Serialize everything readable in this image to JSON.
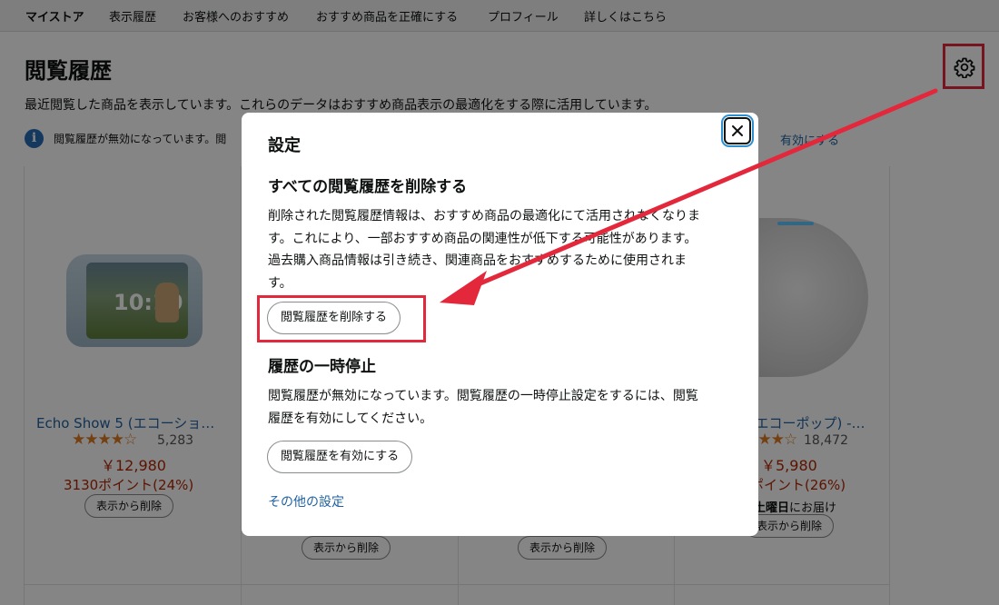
{
  "nav": {
    "items": [
      "マイストア",
      "表示履歴",
      "お客様へのおすすめ",
      "おすすめ商品を正確にする",
      "プロフィール",
      "詳しくはこちら"
    ]
  },
  "page": {
    "title": "閲覧履歴",
    "description": "最近閲覧した商品を表示しています。これらのデータはおすすめ商品表示の最適化をする際に活用しています。",
    "info_text": "閲覧履歴が無効になっています。閲",
    "info_link": "有効にする"
  },
  "products": [
    {
      "title": "Echo Show 5 (エコーショ…",
      "rating_stars": "★★★★☆",
      "rating_count": "5,283",
      "price": "￥12,980",
      "points": "3130ポイント(24%)",
      "remove_label": "表示から削除"
    },
    {
      "remove_label": "表示から削除"
    },
    {
      "remove_label": "表示から削除"
    },
    {
      "title": ") (エコーポップ) -…",
      "rating_stars": "★★★★☆",
      "rating_count": "18,472",
      "price": "￥5,980",
      "points": "ポイント(26%)",
      "delivery_bold": "土曜日",
      "delivery_rest": "にお届け",
      "remove_label": "表示から削除"
    }
  ],
  "echo_show_screen_time": "10:10",
  "modal": {
    "title": "設定",
    "delete_section": {
      "title": "すべての閲覧履歴を削除する",
      "body": "削除された閲覧履歴情報は、おすすめ商品の最適化にて活用されなくなります。これにより、一部おすすめ商品の関連性が低下する可能性があります。過去購入商品情報は引き続き、関連商品をおすすめするために使用されます。",
      "button_label": "閲覧履歴を削除する"
    },
    "pause_section": {
      "title": "履歴の一時停止",
      "body": "閲覧履歴が無効になっています。閲覧履歴の一時停止設定をするには、閲覧履歴を有効にしてください。",
      "button_label": "閲覧履歴を有効にする"
    },
    "other_settings_link": "その他の設定"
  },
  "colors": {
    "annotation_red": "#e3283c",
    "link_blue": "#2162a1",
    "price_red": "#b12704",
    "star_orange": "#de7921"
  },
  "icons": [
    "gear-icon",
    "info-icon",
    "close-icon",
    "star-rating-icon"
  ]
}
